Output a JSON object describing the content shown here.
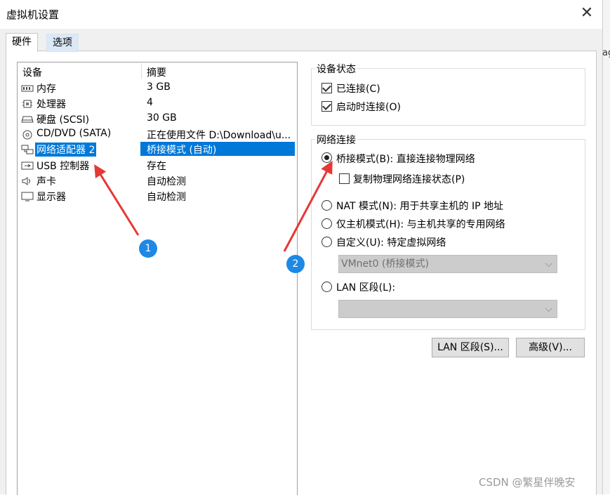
{
  "window": {
    "title": "虚拟机设置",
    "close": "✕"
  },
  "right_edge_text": "ag",
  "tabs": [
    {
      "label": "硬件"
    },
    {
      "label": "选项"
    }
  ],
  "device_list": {
    "col_device": "设备",
    "col_summary": "摘要",
    "rows": [
      {
        "icon": "memory-icon",
        "name": "内存",
        "summary": "3 GB"
      },
      {
        "icon": "processor-icon",
        "name": "处理器",
        "summary": "4"
      },
      {
        "icon": "hard-disk-icon",
        "name": "硬盘 (SCSI)",
        "summary": "30 GB"
      },
      {
        "icon": "cd-dvd-icon",
        "name": "CD/DVD (SATA)",
        "summary": "正在使用文件 D:\\Download\\u..."
      },
      {
        "icon": "network-adapter-icon",
        "name": "网络适配器 2",
        "summary": "桥接模式 (自动)"
      },
      {
        "icon": "usb-icon",
        "name": "USB 控制器",
        "summary": "存在"
      },
      {
        "icon": "sound-card-icon",
        "name": "声卡",
        "summary": "自动检测"
      },
      {
        "icon": "display-icon",
        "name": "显示器",
        "summary": "自动检测"
      }
    ]
  },
  "device_status": {
    "title": "设备状态",
    "connected": "已连接(C)",
    "connect_at_power_on": "启动时连接(O)"
  },
  "network": {
    "title": "网络连接",
    "bridged": "桥接模式(B): 直接连接物理网络",
    "replicate": "复制物理网络连接状态(P)",
    "nat": "NAT 模式(N): 用于共享主机的 IP 地址",
    "host_only": "仅主机模式(H): 与主机共享的专用网络",
    "custom": "自定义(U): 特定虚拟网络",
    "custom_select": "VMnet0 (桥接模式)",
    "lan_segment": "LAN 区段(L):",
    "lan_select": ""
  },
  "buttons": {
    "lan_segments": "LAN 区段(S)...",
    "advanced": "高级(V)..."
  },
  "annotations": {
    "badge1": "1",
    "badge2": "2"
  },
  "watermark": "CSDN @繁星伴晚安",
  "colors": {
    "selection": "#0078d7",
    "arrow": "#e53935",
    "badge": "#1e88e5"
  }
}
